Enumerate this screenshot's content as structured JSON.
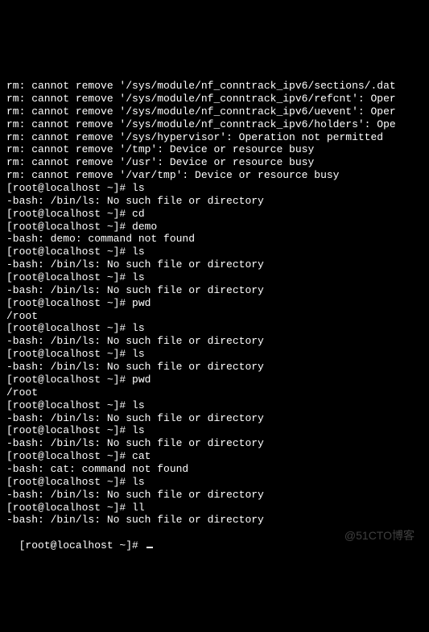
{
  "terminal": {
    "lines": [
      "rm: cannot remove '/sys/module/nf_conntrack_ipv6/sections/.dat",
      "rm: cannot remove '/sys/module/nf_conntrack_ipv6/refcnt': Oper",
      "rm: cannot remove '/sys/module/nf_conntrack_ipv6/uevent': Oper",
      "rm: cannot remove '/sys/module/nf_conntrack_ipv6/holders': Ope",
      "rm: cannot remove '/sys/hypervisor': Operation not permitted",
      "rm: cannot remove '/tmp': Device or resource busy",
      "rm: cannot remove '/usr': Device or resource busy",
      "rm: cannot remove '/var/tmp': Device or resource busy",
      "[root@localhost ~]# ls",
      "-bash: /bin/ls: No such file or directory",
      "[root@localhost ~]# cd",
      "[root@localhost ~]# demo",
      "-bash: demo: command not found",
      "[root@localhost ~]# ls",
      "-bash: /bin/ls: No such file or directory",
      "[root@localhost ~]# ls",
      "-bash: /bin/ls: No such file or directory",
      "[root@localhost ~]# pwd",
      "/root",
      "[root@localhost ~]# ls",
      "-bash: /bin/ls: No such file or directory",
      "[root@localhost ~]# ls",
      "-bash: /bin/ls: No such file or directory",
      "[root@localhost ~]# pwd",
      "/root",
      "[root@localhost ~]# ls",
      "-bash: /bin/ls: No such file or directory",
      "[root@localhost ~]# ls",
      "-bash: /bin/ls: No such file or directory",
      "[root@localhost ~]# cat",
      "-bash: cat: command not found",
      "[root@localhost ~]# ls",
      "-bash: /bin/ls: No such file or directory",
      "[root@localhost ~]# ll",
      "-bash: /bin/ls: No such file or directory"
    ],
    "prompt": "[root@localhost ~]# "
  },
  "watermark": "@51CTO博客"
}
